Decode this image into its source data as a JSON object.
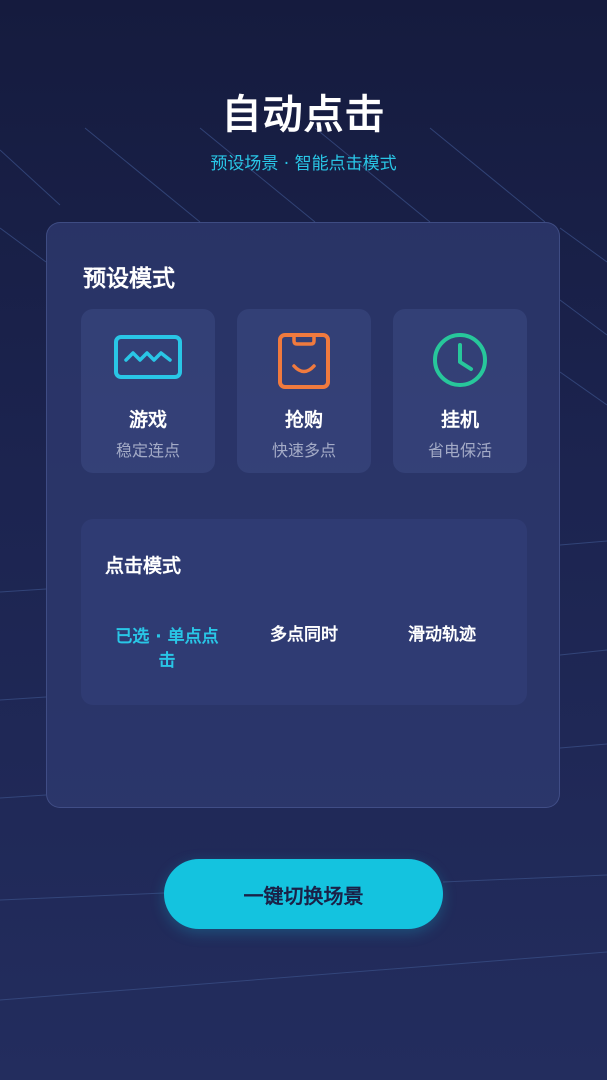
{
  "header": {
    "title": "自动点击",
    "subtitle": "预设场景 · 智能点击模式"
  },
  "presets": {
    "title": "预设模式",
    "modes": [
      {
        "name": "游戏",
        "desc": "稳定连点",
        "icon": "monitor-wave-icon",
        "color": "#29c6e6"
      },
      {
        "name": "抢购",
        "desc": "快速多点",
        "icon": "shopping-bag-icon",
        "color": "#f07a3e"
      },
      {
        "name": "挂机",
        "desc": "省电保活",
        "icon": "clock-icon",
        "color": "#27c79b"
      }
    ]
  },
  "click_mode": {
    "title": "点击模式",
    "options": [
      {
        "label": "已选 · 单点点击",
        "selected": true
      },
      {
        "label": "多点同时",
        "selected": false
      },
      {
        "label": "滑动轨迹",
        "selected": false
      }
    ]
  },
  "cta": {
    "label": "一键切换场景"
  },
  "colors": {
    "accent": "#29c6e6",
    "button": "#14c3df",
    "background": "#1c2450"
  }
}
